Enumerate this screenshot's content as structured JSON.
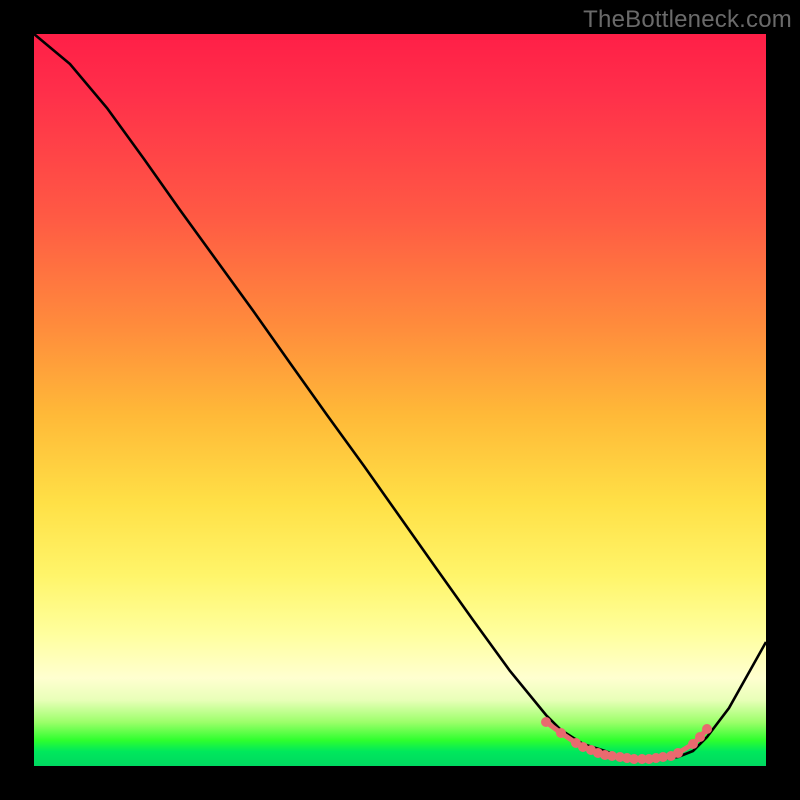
{
  "watermark": "TheBottleneck.com",
  "chart_data": {
    "type": "line",
    "title": "",
    "xlabel": "",
    "ylabel": "",
    "xlim": [
      0,
      100
    ],
    "ylim": [
      0,
      100
    ],
    "series": [
      {
        "name": "curve",
        "x": [
          0,
          5,
          10,
          15,
          20,
          25,
          30,
          35,
          40,
          45,
          50,
          55,
          60,
          65,
          70,
          72,
          75,
          78,
          80,
          82,
          84,
          86,
          88,
          90,
          92,
          95,
          100
        ],
        "y": [
          100,
          96,
          90,
          83,
          76,
          69,
          62,
          55,
          48,
          41,
          34,
          27,
          20,
          13,
          7,
          5,
          3,
          2,
          1.2,
          1,
          1,
          1,
          1.2,
          2,
          4,
          8,
          17
        ]
      }
    ],
    "markers": {
      "name": "highlight-dots",
      "color": "#e96a6f",
      "x": [
        70,
        72,
        74,
        75,
        76,
        77,
        78,
        79,
        80,
        81,
        82,
        83,
        84,
        85,
        86,
        87,
        88,
        90,
        91,
        92
      ],
      "y": [
        6,
        4.5,
        3.2,
        2.6,
        2.2,
        1.8,
        1.5,
        1.3,
        1.2,
        1.1,
        1,
        1,
        1,
        1.1,
        1.2,
        1.4,
        1.8,
        3,
        4,
        5
      ]
    }
  }
}
